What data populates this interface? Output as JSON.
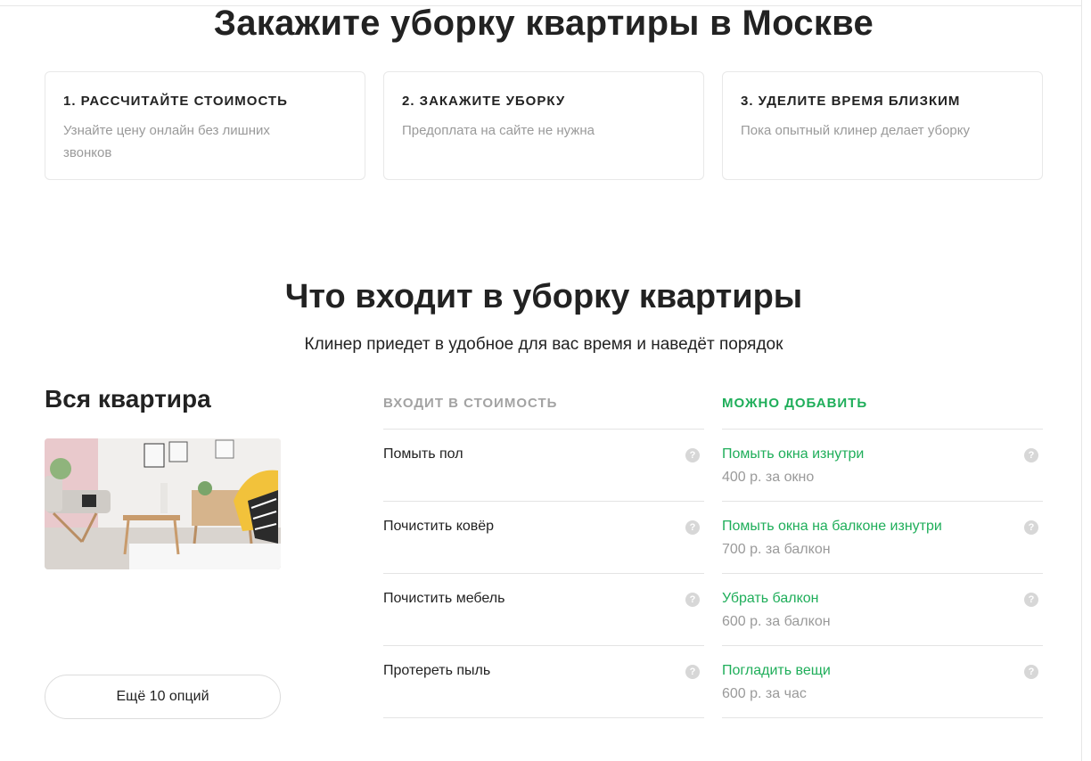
{
  "header": {
    "title": "Закажите уборку квартиры в Москве"
  },
  "steps": [
    {
      "title": "1. Рассчитайте стоимость",
      "desc": "Узнайте цену онлайн без лишних звонков"
    },
    {
      "title": "2. Закажите уборку",
      "desc": "Предоплата на сайте не нужна"
    },
    {
      "title": "3. Уделите время близким",
      "desc": "Пока опытный клинер делает уборку"
    }
  ],
  "included_section": {
    "title": "Что входит в уборку квартиры",
    "subtitle": "Клинер приедет в удобное для вас время и наведёт порядок"
  },
  "room": {
    "title": "Вся квартира",
    "more_button": "Ещё 10 опций"
  },
  "included": {
    "heading": "Входит в стоимость",
    "items": [
      {
        "name": "Помыть пол"
      },
      {
        "name": "Почистить ковёр"
      },
      {
        "name": "Почистить мебель"
      },
      {
        "name": "Протереть пыль"
      }
    ]
  },
  "addons": {
    "heading": "Можно добавить",
    "items": [
      {
        "name": "Помыть окна изнутри",
        "price": "400 р. за окно"
      },
      {
        "name": "Помыть окна на балконе изнутри",
        "price": "700 р. за балкон"
      },
      {
        "name": "Убрать балкон",
        "price": "600 р. за балкон"
      },
      {
        "name": "Погладить вещи",
        "price": "600 р. за час"
      }
    ]
  },
  "help_icon": {
    "glyph": "?"
  },
  "colors": {
    "accent_green": "#1fae5a",
    "muted": "#9a9a9a"
  }
}
